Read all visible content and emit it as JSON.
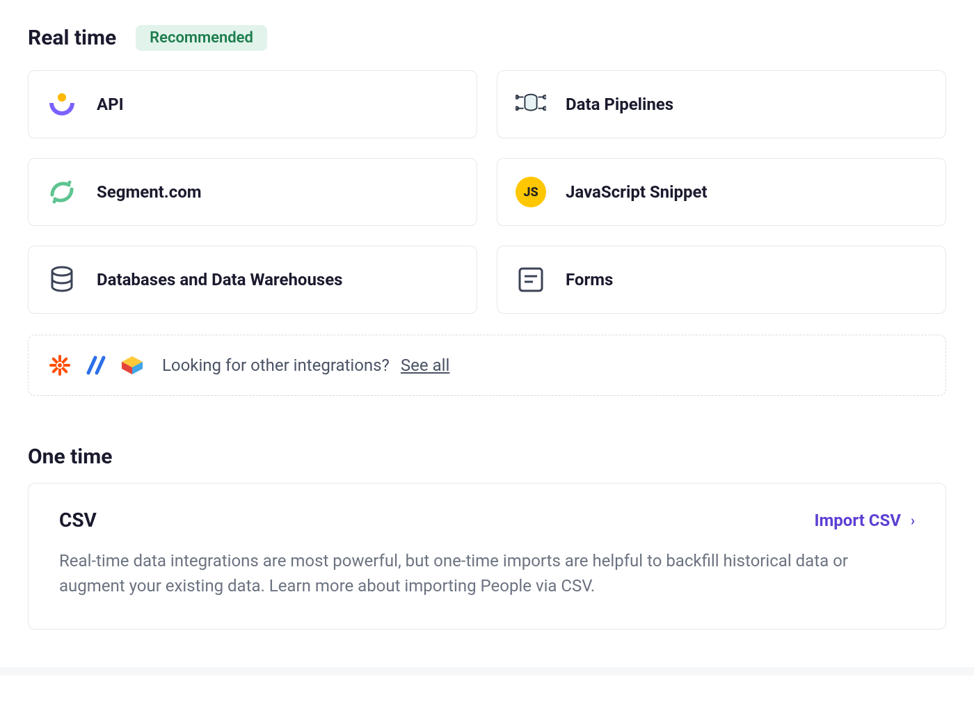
{
  "sections": {
    "realtime": {
      "title": "Real time",
      "badge": "Recommended",
      "cards": [
        {
          "label": "API"
        },
        {
          "label": "Data Pipelines"
        },
        {
          "label": "Segment.com"
        },
        {
          "label": "JavaScript Snippet"
        },
        {
          "label": "Databases and Data Warehouses"
        },
        {
          "label": "Forms"
        }
      ],
      "integrations_prompt": "Looking for other integrations?",
      "integrations_link": "See all"
    },
    "onetime": {
      "title": "One time",
      "card_title": "CSV",
      "action_label": "Import CSV",
      "description": "Real-time data integrations are most powerful, but one-time imports are helpful to backfill historical data or augment your existing data. Learn more about importing People via CSV."
    }
  }
}
